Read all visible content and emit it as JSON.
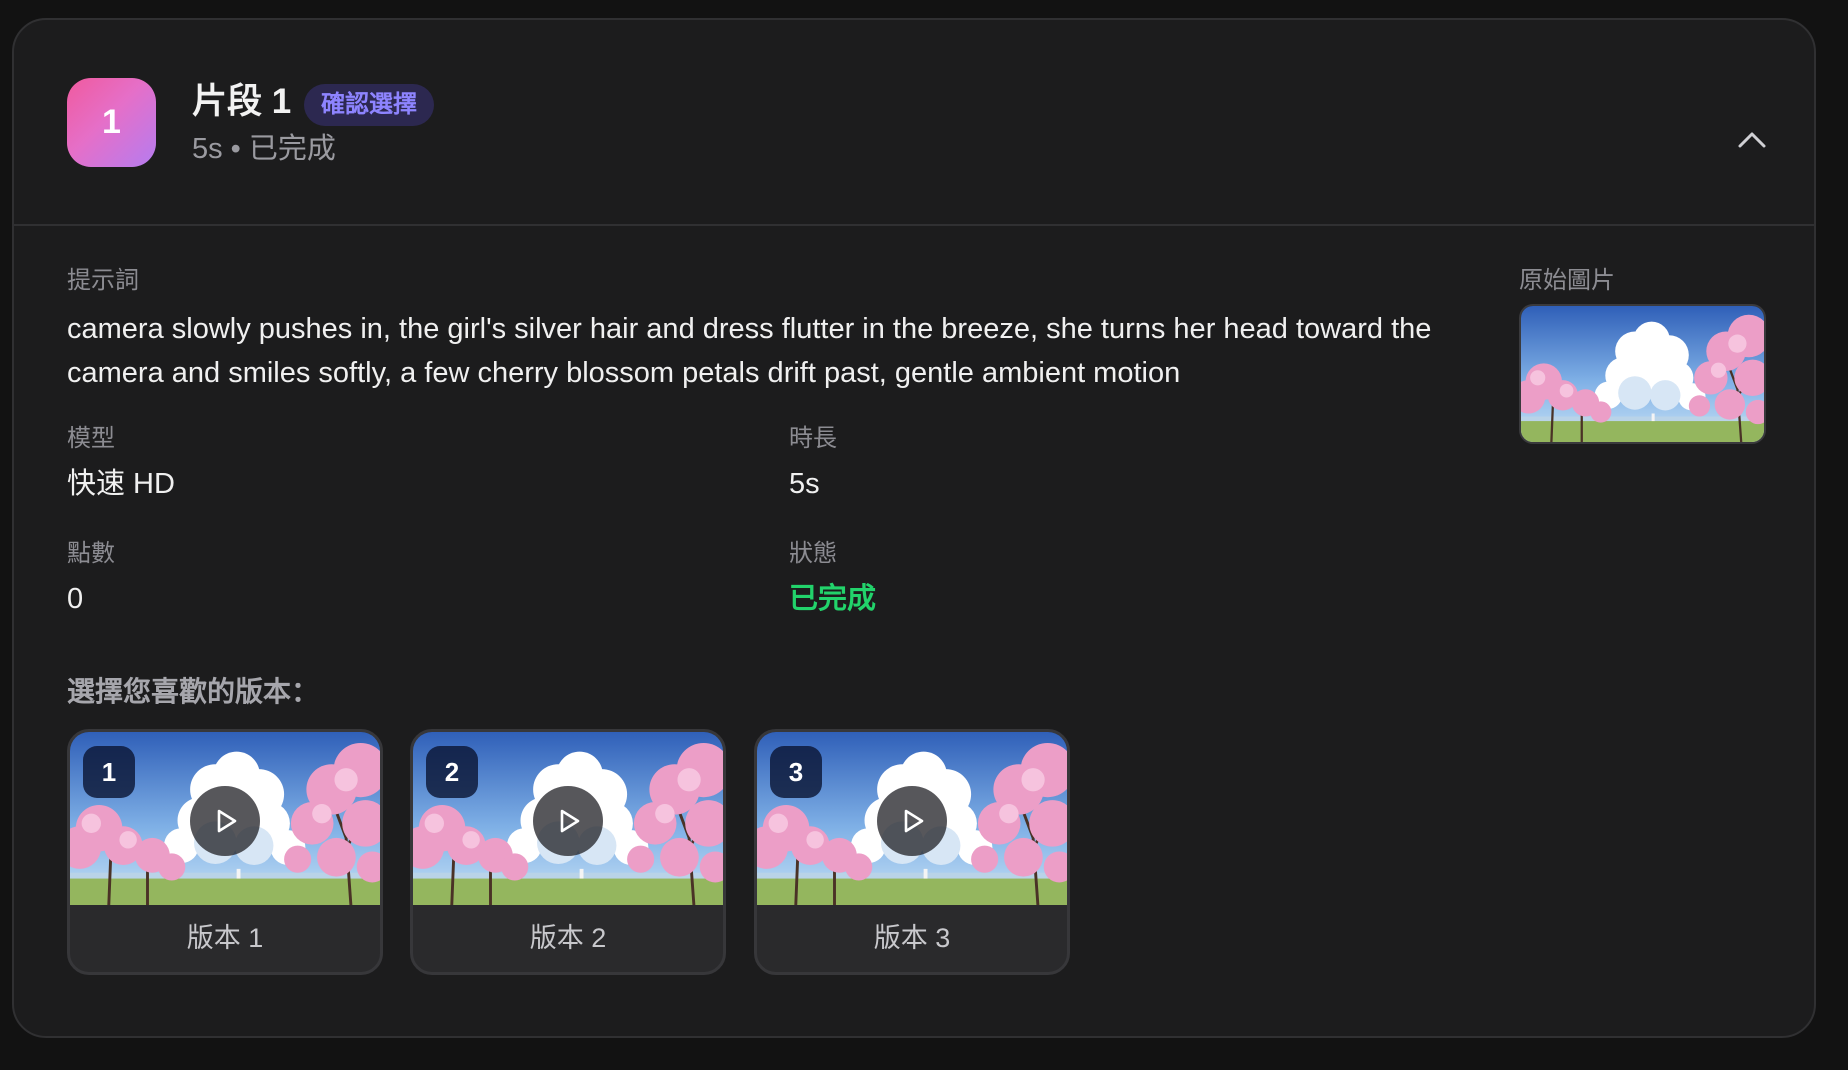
{
  "segment": {
    "number": "1",
    "title": "片段 1",
    "confirm_badge": "確認選擇",
    "subtitle": "5s • 已完成",
    "icons": {
      "collapse": "chevron-up-icon"
    }
  },
  "details": {
    "prompt_label": "提示詞",
    "prompt": "camera slowly pushes in, the girl's silver hair and dress flutter in the breeze, she turns her head toward the camera and smiles softly, a few cherry blossom petals drift past, gentle ambient motion",
    "original_image_label": "原始圖片",
    "model_label": "模型",
    "model_value": "快速 HD",
    "duration_label": "時長",
    "duration_value": "5s",
    "points_label": "點數",
    "points_value": "0",
    "status_label": "狀態",
    "status_value": "已完成"
  },
  "versions": {
    "heading": "選擇您喜歡的版本：",
    "items": [
      {
        "num": "1",
        "label": "版本 1"
      },
      {
        "num": "2",
        "label": "版本 2"
      },
      {
        "num": "3",
        "label": "版本 3"
      }
    ]
  },
  "colors": {
    "background": "#121212",
    "card": "#1c1c1d",
    "accent_badge": "#8e84ff",
    "status_success": "#22d36b",
    "number_gradient": [
      "#f05a9e",
      "#b57cf0"
    ]
  }
}
